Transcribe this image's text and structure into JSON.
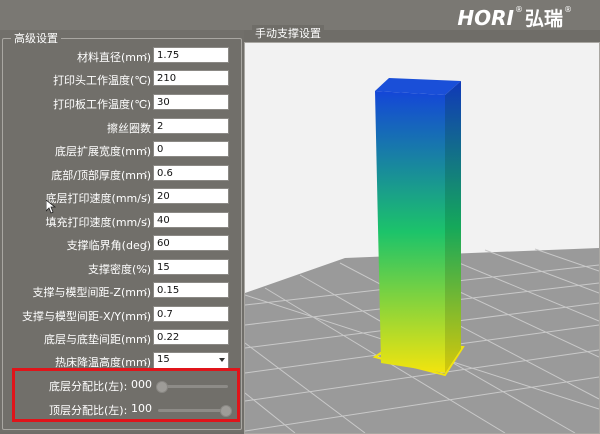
{
  "brand": {
    "latin": "HORI",
    "cjk": "弘瑞",
    "reg_mark": "®"
  },
  "settings": {
    "title": "高级设置",
    "colon": ":",
    "rows": [
      {
        "label": "材料直径(mm)",
        "value": "1.75"
      },
      {
        "label": "打印头工作温度(℃)",
        "value": "210"
      },
      {
        "label": "打印板工作温度(℃)",
        "value": "30"
      },
      {
        "label": "擦丝圈数",
        "value": "2"
      },
      {
        "label": "底层扩展宽度(mm)",
        "value": "0"
      },
      {
        "label": "底部/顶部厚度(mm)",
        "value": "0.6"
      },
      {
        "label": "底层打印速度(mm/s)",
        "value": "20"
      },
      {
        "label": "填充打印速度(mm/s)",
        "value": "40"
      },
      {
        "label": "支撑临界角(deg)",
        "value": "60"
      },
      {
        "label": "支撑密度(%)",
        "value": "15"
      },
      {
        "label": "支撑与模型间距-Z(mm)",
        "value": "0.15"
      },
      {
        "label": "支撑与模型间距-X/Y(mm)",
        "value": "0.7"
      },
      {
        "label": "底层与底垫间距(mm)",
        "value": "0.22"
      }
    ],
    "bed_cooling": {
      "label": "热床降温高度(mm)",
      "value": "15"
    },
    "sliders": [
      {
        "label": "底层分配比(左):",
        "value": "000",
        "level": 0.0
      },
      {
        "label": "顶层分配比(左):",
        "value": "100",
        "level": 1.0
      }
    ]
  },
  "support_panel": {
    "title": "手动支撑设置"
  },
  "colors": {
    "highlight": "#e0141a",
    "model_top": "#1446d8",
    "model_mid": "#1cc36a",
    "model_bottom": "#f2e40e",
    "grid": "#c9c9c9",
    "background": "#f2f2f2"
  }
}
